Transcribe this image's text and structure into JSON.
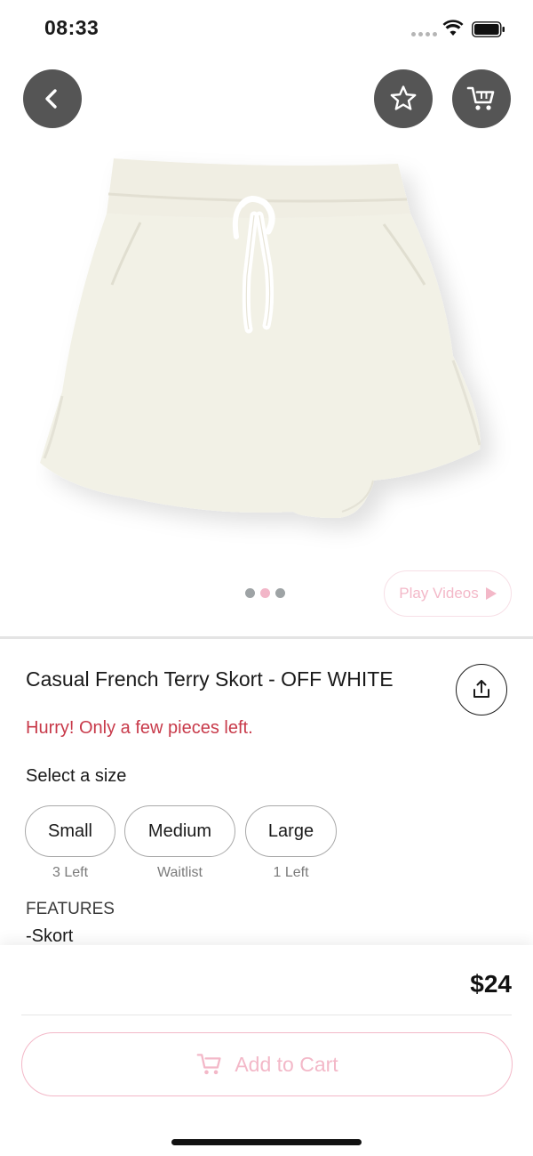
{
  "status_bar": {
    "time": "08:33"
  },
  "header": {
    "back_icon": "chevron-left-icon",
    "favorite_icon": "star-icon",
    "cart_icon": "cart-icon"
  },
  "gallery": {
    "image_alt": "Off white skort product photo",
    "active_dot_index": 1,
    "dot_count": 3,
    "play_videos_label": "Play Videos"
  },
  "product": {
    "title": "Casual French Terry Skort - OFF WHITE",
    "stock_warning": "Hurry! Only a few pieces left.",
    "select_size_label": "Select a size",
    "sizes": [
      {
        "label": "Small",
        "note": "3 Left"
      },
      {
        "label": "Medium",
        "note": "Waitlist"
      },
      {
        "label": "Large",
        "note": "1 Left"
      }
    ],
    "features_heading": "FEATURES",
    "features": [
      "-Skort"
    ]
  },
  "checkout": {
    "price": "$24",
    "add_to_cart_label": "Add to Cart"
  },
  "colors": {
    "accent_pink": "#f3b8c8",
    "warning_red": "#c83a4a",
    "button_dark": "#555555"
  }
}
